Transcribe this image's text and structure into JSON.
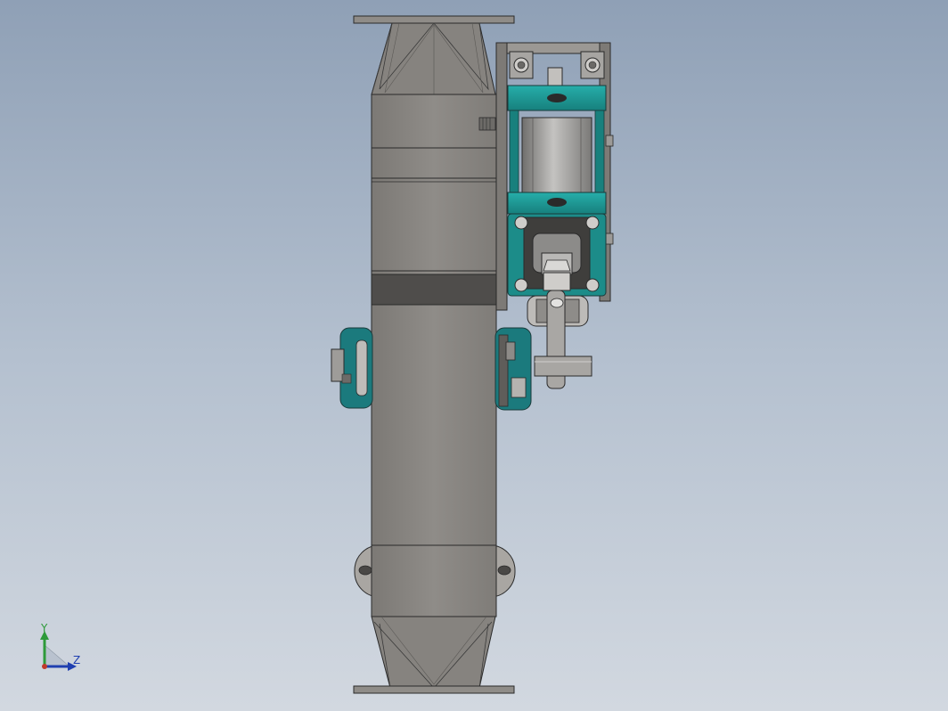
{
  "viewport": {
    "background_top": "#8fa0b6",
    "background_bottom": "#d2d8e0"
  },
  "model": {
    "body_color": "#8a8782",
    "flange_color": "#8f8c88",
    "cylinder_accent_color": "#1f9e9a",
    "bearing_color": "#1c7f82",
    "cylinder_barrel_color": "#9d9c9a",
    "edge_color": "#2a2a2a"
  },
  "triad": {
    "y_label": "Y",
    "z_label": "Z",
    "y_color": "#2e9a3a",
    "z_color": "#1f3fb0"
  }
}
